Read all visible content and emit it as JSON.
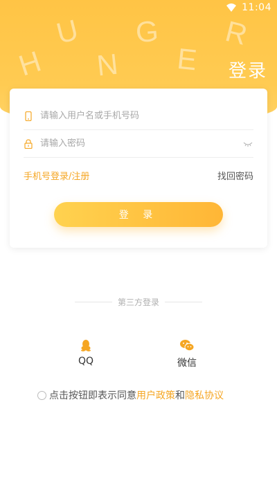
{
  "status_bar": {
    "time": "11:04",
    "wifi_icon": "wifi-icon"
  },
  "header": {
    "letters": [
      "H",
      "U",
      "N",
      "G",
      "E",
      "R"
    ],
    "title": "登录"
  },
  "login_form": {
    "username_placeholder": "请输入用户名或手机号码",
    "password_placeholder": "请输入密码",
    "phone_login_label": "手机号登录/注册",
    "forgot_password_label": "找回密码",
    "login_button_label": "登 录"
  },
  "third_party": {
    "title": "第三方登录",
    "qq_label": "QQ",
    "wechat_label": "微信"
  },
  "agreement": {
    "prefix": "点击按钮即表示同意",
    "user_policy": "用户政策",
    "and": "和",
    "privacy": "隐私协议"
  },
  "colors": {
    "accent": "#f5a623",
    "header": "#ffc445"
  }
}
